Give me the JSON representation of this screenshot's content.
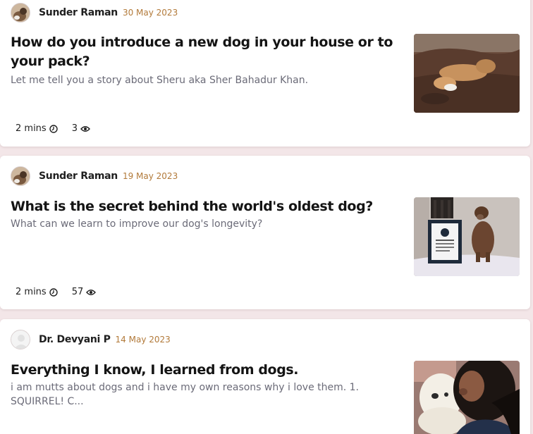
{
  "posts": [
    {
      "author": "Sunder Raman",
      "date": "30 May 2023",
      "title": "How do you introduce a new dog in your house or to your pack?",
      "excerpt": "Let me tell you a story about Sheru aka Sher Bahadur Khan.",
      "read_time": "2 mins",
      "views": "3",
      "thumbnail_icon": "dog-on-couch-image"
    },
    {
      "author": "Sunder Raman",
      "date": "19 May 2023",
      "title": "What is the secret behind the world's oldest dog?",
      "excerpt": "What can we learn to improve our dog's longevity?",
      "read_time": "2 mins",
      "views": "57",
      "thumbnail_icon": "dog-with-certificate-image"
    },
    {
      "author": "Dr. Devyani P",
      "date": "14 May 2023",
      "title": "Everything I know, I learned from dogs.",
      "excerpt": "i am mutts about dogs and i have my own reasons why i love them. 1. SQUIRREL! C...",
      "thumbnail_icon": "woman-kissing-puppy-image"
    }
  ],
  "colors": {
    "page_background": "#f3e6e8",
    "date": "#b27a3a",
    "excerpt": "#6b6b78"
  }
}
